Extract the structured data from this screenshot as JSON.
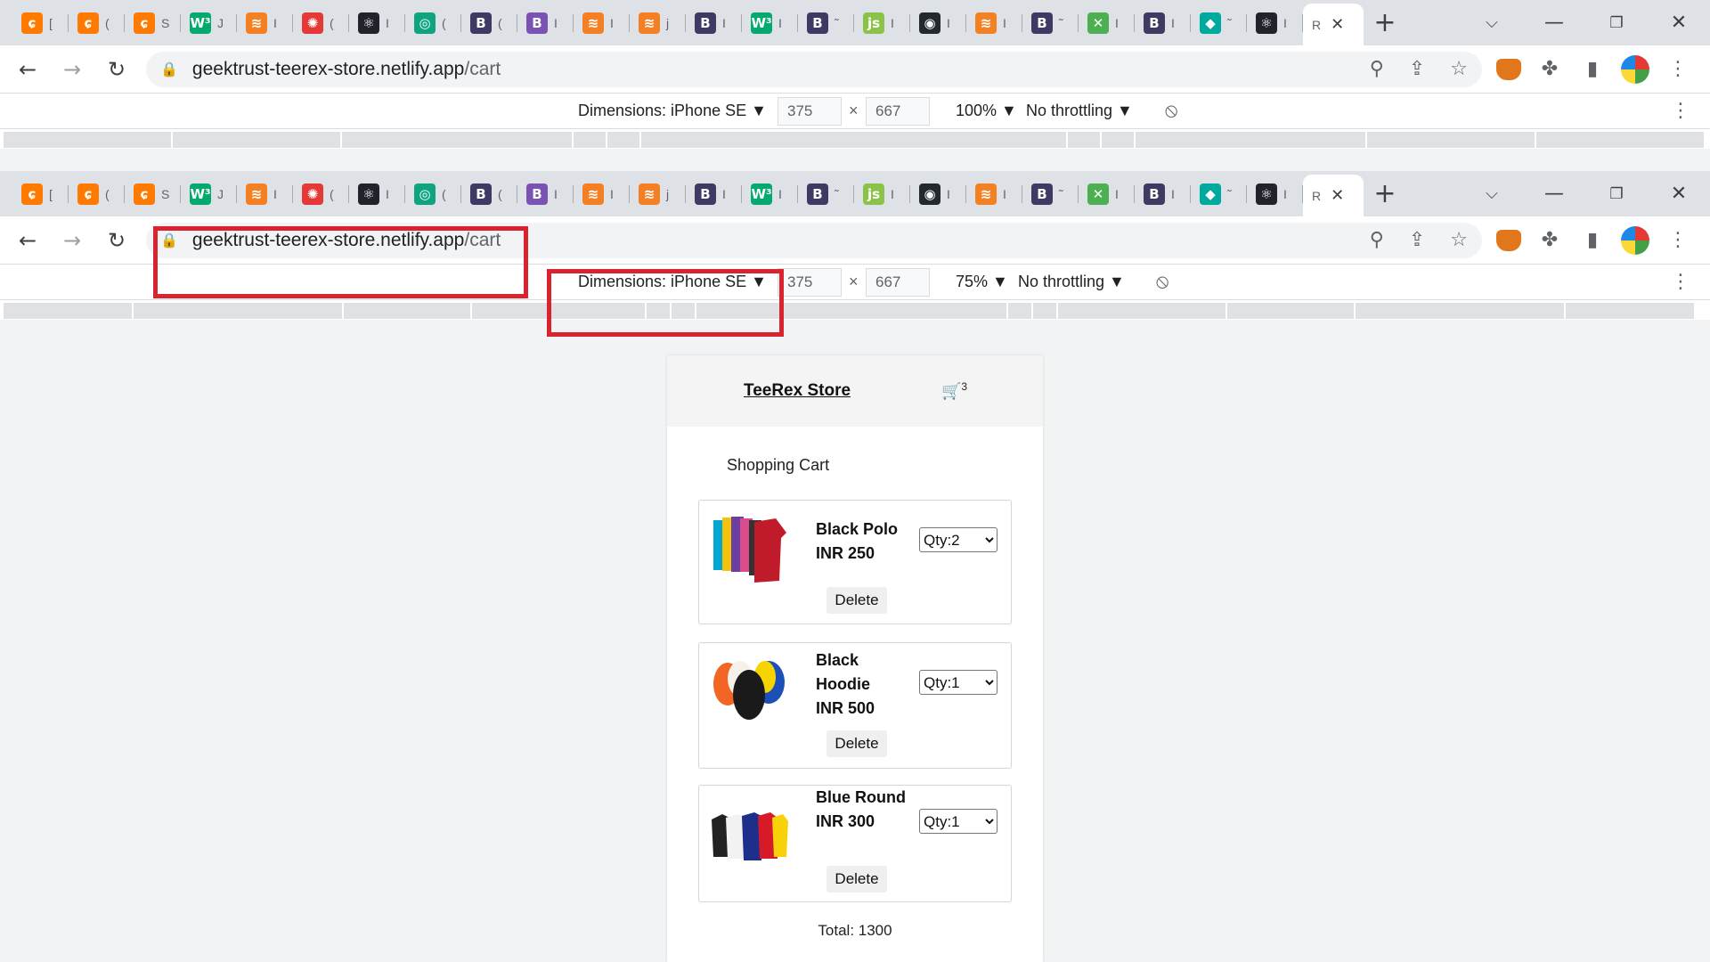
{
  "browser_top": {
    "tabs": [
      {
        "icon": "geektrust-icon",
        "glyph": "ɕ",
        "color": "#ff7a00",
        "label": "["
      },
      {
        "icon": "geektrust-icon",
        "glyph": "ɕ",
        "color": "#ff7a00",
        "label": "("
      },
      {
        "icon": "geektrust-icon",
        "glyph": "ɕ",
        "color": "#ff7a00",
        "label": "S"
      },
      {
        "icon": "w3schools-icon",
        "glyph": "W³",
        "color": "#04aa6d",
        "label": "J"
      },
      {
        "icon": "stackoverflow-icon",
        "glyph": "≋",
        "color": "#f48024",
        "label": "I"
      },
      {
        "icon": "octopus-icon",
        "glyph": "✺",
        "color": "#e53935",
        "label": "("
      },
      {
        "icon": "react-icon",
        "glyph": "⚛",
        "color": "#20232a",
        "label": "I"
      },
      {
        "icon": "chatgpt-icon",
        "glyph": "◎",
        "color": "#10a37f",
        "label": "("
      },
      {
        "icon": "bootstrap-icon",
        "glyph": "B",
        "color": "#3d3a63",
        "label": "("
      },
      {
        "icon": "bootstrap-icon",
        "glyph": "B",
        "color": "#7952b3",
        "label": "I"
      },
      {
        "icon": "stackoverflow-icon",
        "glyph": "≋",
        "color": "#f48024",
        "label": "I"
      },
      {
        "icon": "stackoverflow-icon",
        "glyph": "≋",
        "color": "#f48024",
        "label": "j"
      },
      {
        "icon": "bootstrap-icon",
        "glyph": "B",
        "color": "#3d3a63",
        "label": "I"
      },
      {
        "icon": "w3schools-icon",
        "glyph": "W³",
        "color": "#04aa6d",
        "label": "I"
      },
      {
        "icon": "bootstrap-icon",
        "glyph": "B",
        "color": "#3d3a63",
        "label": "˜"
      },
      {
        "icon": "js-icon",
        "glyph": "js",
        "color": "#8bc34a",
        "label": "I"
      },
      {
        "icon": "github-icon",
        "glyph": "◉",
        "color": "#24292e",
        "label": "I"
      },
      {
        "icon": "stackoverflow-icon",
        "glyph": "≋",
        "color": "#f48024",
        "label": "I"
      },
      {
        "icon": "bootstrap-icon",
        "glyph": "B",
        "color": "#3d3a63",
        "label": "˜"
      },
      {
        "icon": "pinwheel-icon",
        "glyph": "✕",
        "color": "#4caf50",
        "label": "I"
      },
      {
        "icon": "bootstrap-icon",
        "glyph": "B",
        "color": "#3d3a63",
        "label": "I"
      },
      {
        "icon": "diamond-icon",
        "glyph": "◆",
        "color": "#00a99d",
        "label": "˜"
      },
      {
        "icon": "react-icon",
        "glyph": "⚛",
        "color": "#20232a",
        "label": "I"
      }
    ],
    "active_tab": {
      "label": "R"
    },
    "url_host": "geektrust-teerex-store.netlify.app",
    "url_path": "/cart",
    "device": "Dimensions: iPhone SE ▼",
    "width": "375",
    "height": "667",
    "zoom": "100% ▼",
    "throttling": "No throttling ▼"
  },
  "browser_bottom": {
    "url_host": "geektrust-teerex-store.netlify.app",
    "url_path": "/cart",
    "device": "Dimensions: iPhone SE ▼",
    "width": "375",
    "height": "667",
    "zoom": "75% ▼",
    "throttling": "No throttling ▼"
  },
  "store": {
    "title": "TeeRex Store",
    "cart_count": "3",
    "heading": "Shopping Cart",
    "items": [
      {
        "name": "Black Polo",
        "price": "INR 250",
        "qty": "Qty:2",
        "delete": "Delete"
      },
      {
        "name": "Black Hoodie",
        "price": "INR 500",
        "qty": "Qty:1",
        "delete": "Delete"
      },
      {
        "name": "Blue Round",
        "price": "INR 300",
        "qty": "Qty:1",
        "delete": "Delete"
      }
    ],
    "total": "Total: 1300"
  },
  "colors": {
    "highlight": "#d9232e",
    "accent": "#1a73e8"
  }
}
